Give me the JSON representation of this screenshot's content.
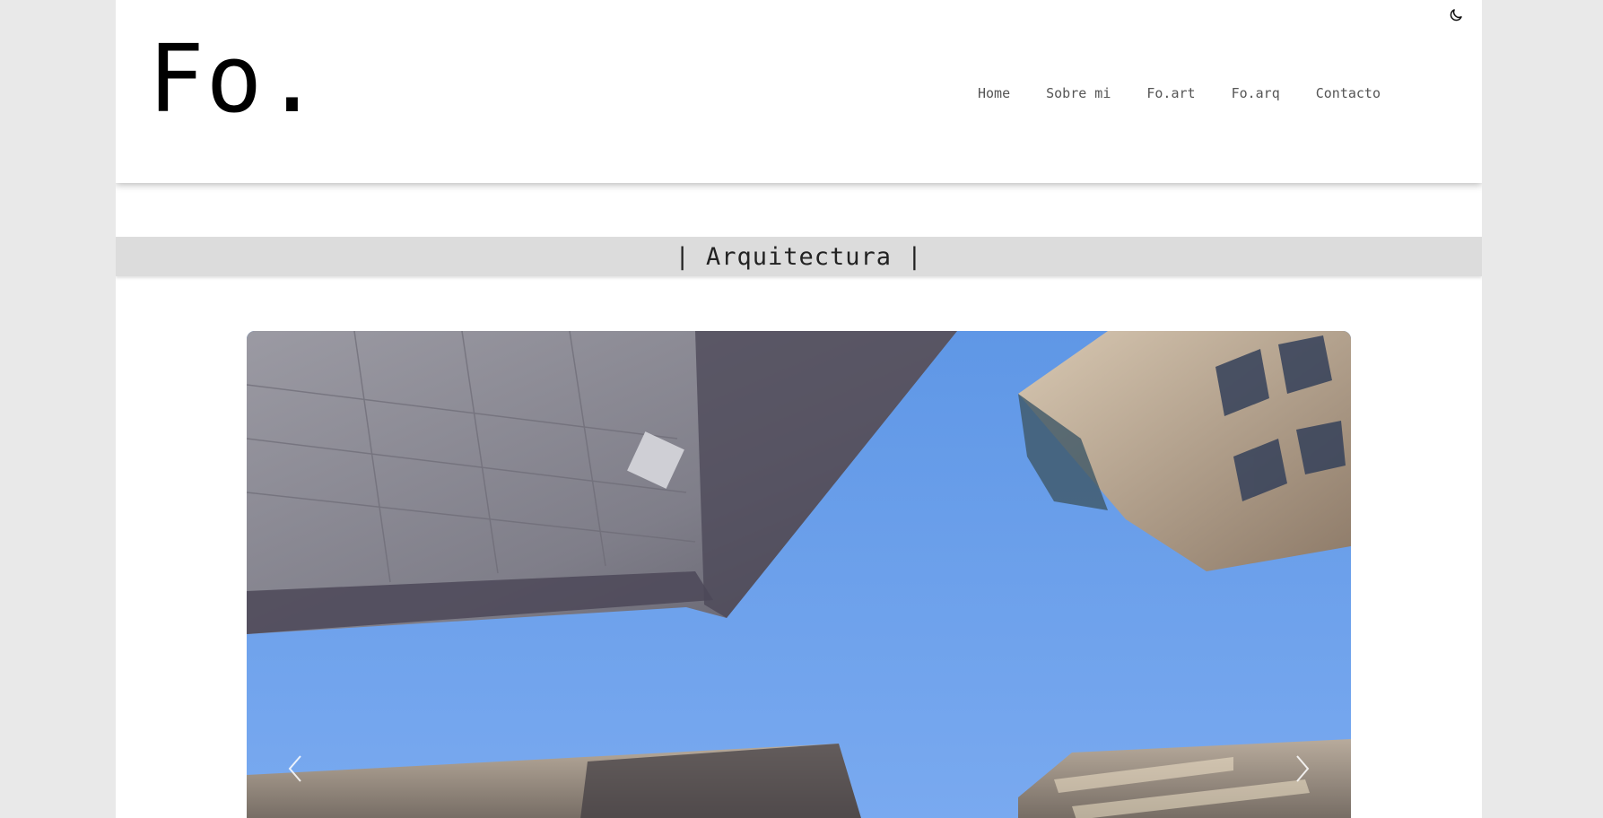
{
  "header": {
    "logo": "Fo.",
    "theme_toggle_icon": "moon-icon",
    "nav": [
      {
        "label": "Home"
      },
      {
        "label": "Sobre mi"
      },
      {
        "label": "Fo.art"
      },
      {
        "label": "Fo.arq"
      },
      {
        "label": "Contacto"
      }
    ]
  },
  "section": {
    "title": "| Arquitectura |"
  },
  "carousel": {
    "prev_icon": "chevron-left-icon",
    "next_icon": "chevron-right-icon",
    "image_icon": "photo-buildings-looking-up"
  },
  "colors": {
    "background": "#e9e9e9",
    "page": "#ffffff",
    "section_bar": "#dcdcdc",
    "sky": "#6fa3ea",
    "nav_text": "#555555"
  }
}
